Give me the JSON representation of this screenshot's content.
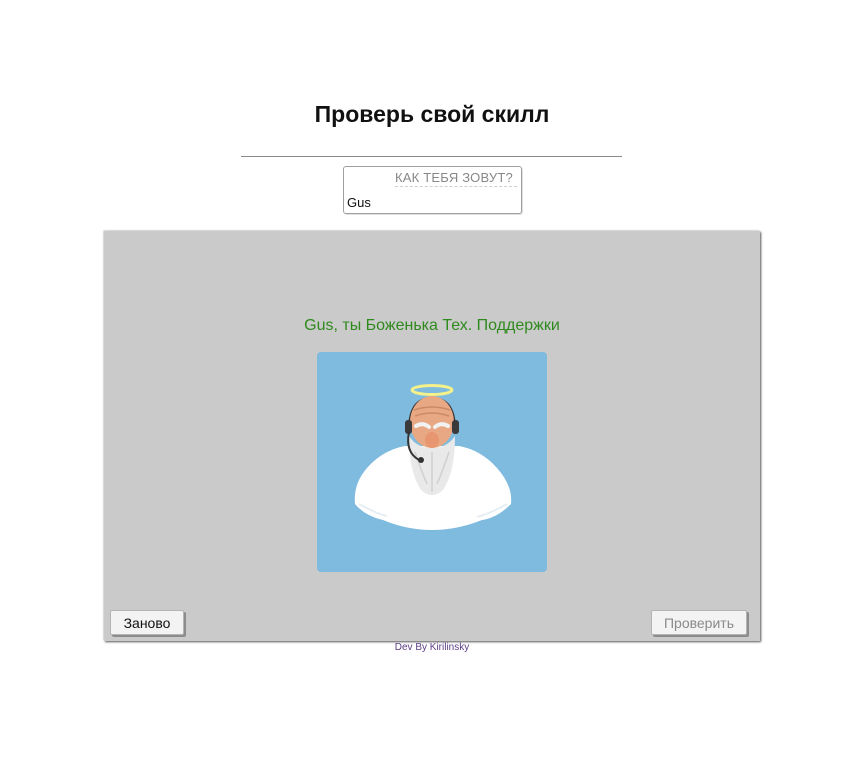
{
  "header": {
    "title": "Проверь свой скилл"
  },
  "name_field": {
    "label": "КАК ТЕБЯ ЗОВУТ?",
    "value": "Gus"
  },
  "quiz": {
    "result_text": "Gus, ты Боженька Тех. Поддержки",
    "result_color": "#2f8a1e",
    "image_icon": "tech-support-god-illustration",
    "image_background": "#7fbadf"
  },
  "controls": {
    "restart_label": "Заново",
    "check_label": "Проверить"
  },
  "footer": {
    "credit": "Dev By Kirilinsky"
  }
}
